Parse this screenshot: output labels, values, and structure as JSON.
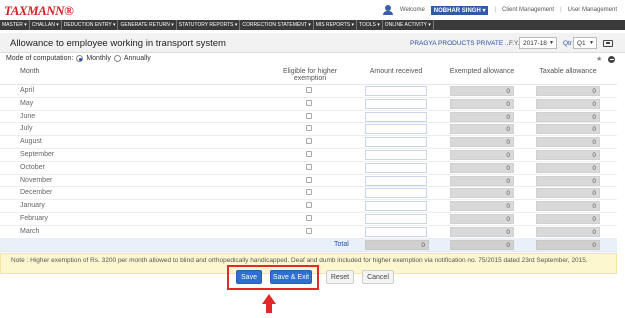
{
  "app": {
    "logo": "TAXMANN®"
  },
  "topbar": {
    "welcome": "Welcome",
    "user_name": "NOBHAR SINGH ▾",
    "client_mgmt": "Client Management",
    "user_mgmt": "User Management"
  },
  "nav": [
    "MASTER ▾",
    "CHALLAN ▾",
    "DEDUCTION ENTRY ▾",
    "GENERATE RETURN ▾",
    "STATUTORY REPORTS ▾",
    "CORRECTION STATEMENT ▾",
    "MIS REPORTS ▾",
    "TOOLS ▾",
    "ONLINE ACTIVITY ▾"
  ],
  "header": {
    "title": "Allowance to employee working in transport system",
    "company": "PRAGYA PRODUCTS PRIVATE ...",
    "fy_label": "F.Y.",
    "fy_value": "2017-18",
    "qtr_label": "Qtr",
    "qtr_value": "Q1"
  },
  "mode": {
    "label": "Mode of computation:",
    "options": [
      "Monthly",
      "Annually"
    ],
    "selected": "Monthly"
  },
  "table": {
    "columns": {
      "month": "Month",
      "eligible": "Eligible for higher exemption",
      "amount": "Amount received",
      "exempted": "Exempted allowance",
      "taxable": "Taxable allowance"
    },
    "rows": [
      {
        "month": "April",
        "exempted": "0",
        "taxable": "0"
      },
      {
        "month": "May",
        "exempted": "0",
        "taxable": "0"
      },
      {
        "month": "June",
        "exempted": "0",
        "taxable": "0"
      },
      {
        "month": "July",
        "exempted": "0",
        "taxable": "0"
      },
      {
        "month": "August",
        "exempted": "0",
        "taxable": "0"
      },
      {
        "month": "September",
        "exempted": "0",
        "taxable": "0"
      },
      {
        "month": "October",
        "exempted": "0",
        "taxable": "0"
      },
      {
        "month": "November",
        "exempted": "0",
        "taxable": "0"
      },
      {
        "month": "December",
        "exempted": "0",
        "taxable": "0"
      },
      {
        "month": "January",
        "exempted": "0",
        "taxable": "0"
      },
      {
        "month": "February",
        "exempted": "0",
        "taxable": "0"
      },
      {
        "month": "March",
        "exempted": "0",
        "taxable": "0"
      }
    ],
    "total": {
      "label": "Total",
      "amount": "0",
      "exempted": "0",
      "taxable": "0"
    }
  },
  "note": "Note : Higher exemption of Rs. 3200 per month allowed to blind and orthopedically handicapped. Deaf and dumb included for higher exemption via notification no. 75/2015 dated 23rd September, 2015.",
  "buttons": {
    "save": "Save",
    "save_exit": "Save & Exit",
    "reset": "Reset",
    "cancel": "Cancel"
  },
  "colors": {
    "accent": "#2f6fd1",
    "highlight": "#e22828",
    "brand": "#d2232a"
  }
}
